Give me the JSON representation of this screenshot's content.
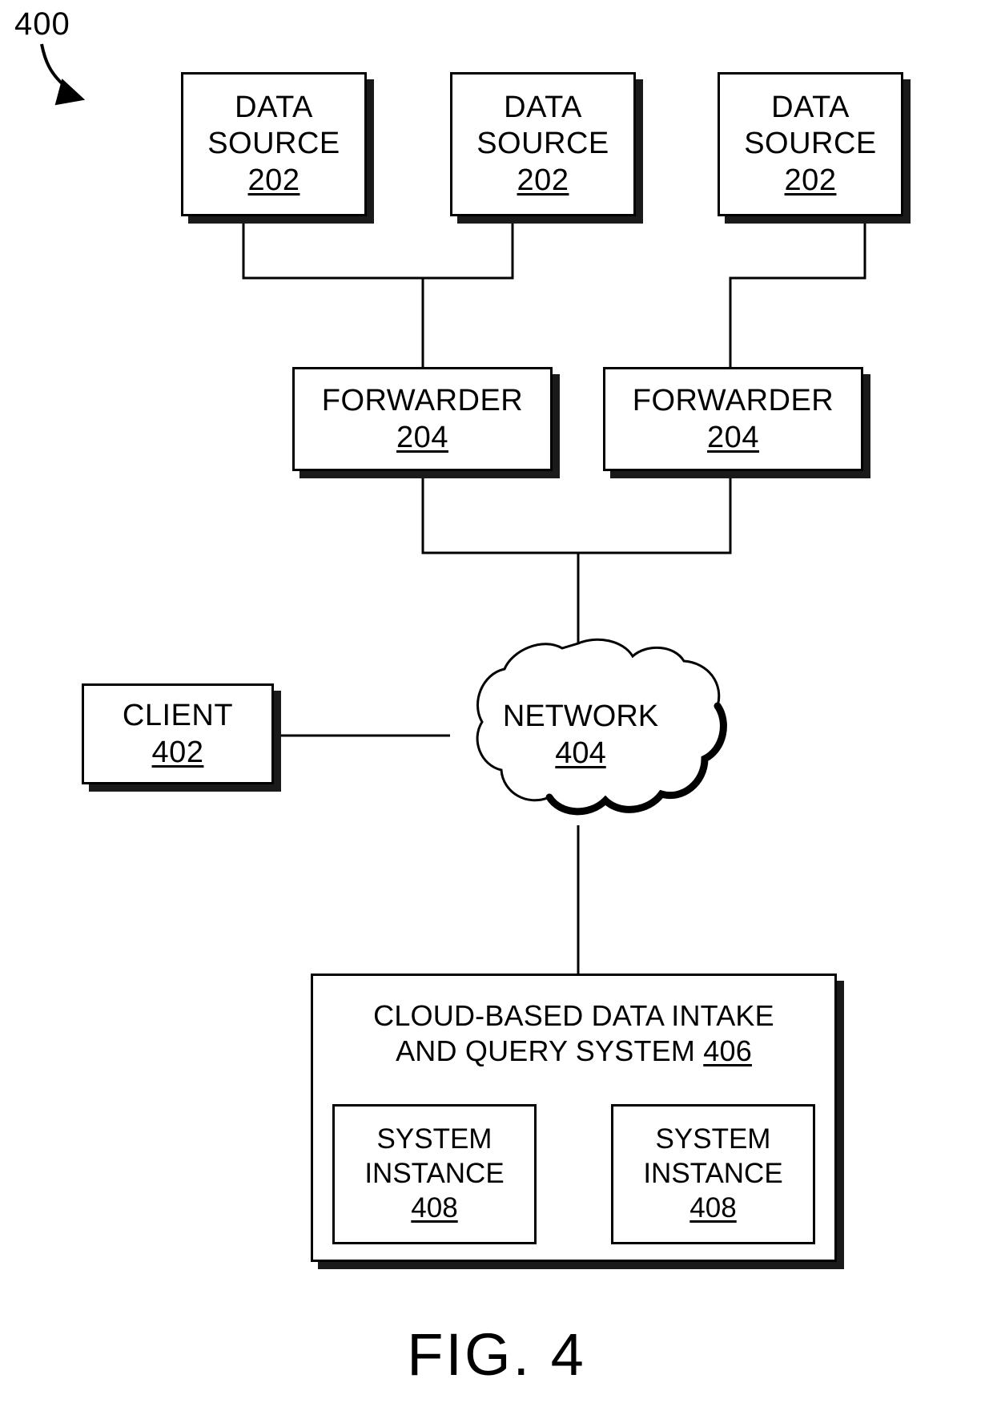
{
  "figure": {
    "reference_numeral": "400",
    "caption": "FIG. 4"
  },
  "data_sources": [
    {
      "line1": "DATA",
      "line2": "SOURCE",
      "ref": "202"
    },
    {
      "line1": "DATA",
      "line2": "SOURCE",
      "ref": "202"
    },
    {
      "line1": "DATA",
      "line2": "SOURCE",
      "ref": "202"
    }
  ],
  "forwarders": [
    {
      "label": "FORWARDER",
      "ref": "204"
    },
    {
      "label": "FORWARDER",
      "ref": "204"
    }
  ],
  "client": {
    "label": "CLIENT",
    "ref": "402"
  },
  "network": {
    "label": "NETWORK",
    "ref": "404"
  },
  "cloud_system": {
    "title_line1": "CLOUD-BASED DATA INTAKE",
    "title_line2": "AND QUERY SYSTEM ",
    "ref": "406",
    "instances": [
      {
        "line1": "SYSTEM",
        "line2": "INSTANCE",
        "ref": "408"
      },
      {
        "line1": "SYSTEM",
        "line2": "INSTANCE",
        "ref": "408"
      }
    ]
  },
  "colors": {
    "stroke": "#000000",
    "shadow": "#1a1a1a",
    "background": "#ffffff"
  }
}
